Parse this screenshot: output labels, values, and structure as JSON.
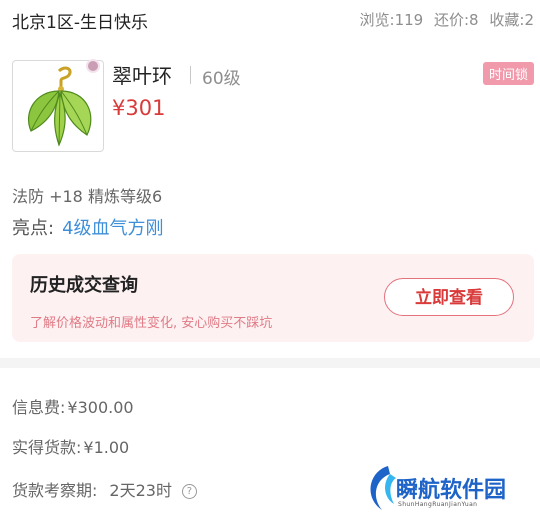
{
  "header": {
    "server_title": "北京1区-生日快乐",
    "views": "浏览:119",
    "bargains": "还价:8",
    "favorites": "收藏:2"
  },
  "item": {
    "name": "翠叶环",
    "level": "60级",
    "price": "¥301",
    "lock_badge": "时间锁",
    "icon": "leaf-ring-icon"
  },
  "attributes": {
    "text": "法防 +18 精炼等级6"
  },
  "highlight": {
    "label": "亮点:",
    "value": "4级血气方刚"
  },
  "history": {
    "title": "历史成交查询",
    "subtitle": "了解价格波动和属性变化, 安心购买不踩坑",
    "button": "立即查看"
  },
  "fees": {
    "info_fee_label": "信息费:",
    "info_fee_value": "¥300.00",
    "received_label": "实得货款:",
    "received_value": "¥1.00",
    "inspection_label": "货款考察期:",
    "inspection_value": "2天23时"
  },
  "watermark": {
    "name": "瞬航软件园",
    "pinyin": "ShunHangRuanJianYuan"
  },
  "colors": {
    "price_red": "#d93a3a",
    "link_blue": "#3f8fd8",
    "badge_pink": "#f09aac",
    "panel_pink": "#fdf1f2"
  }
}
